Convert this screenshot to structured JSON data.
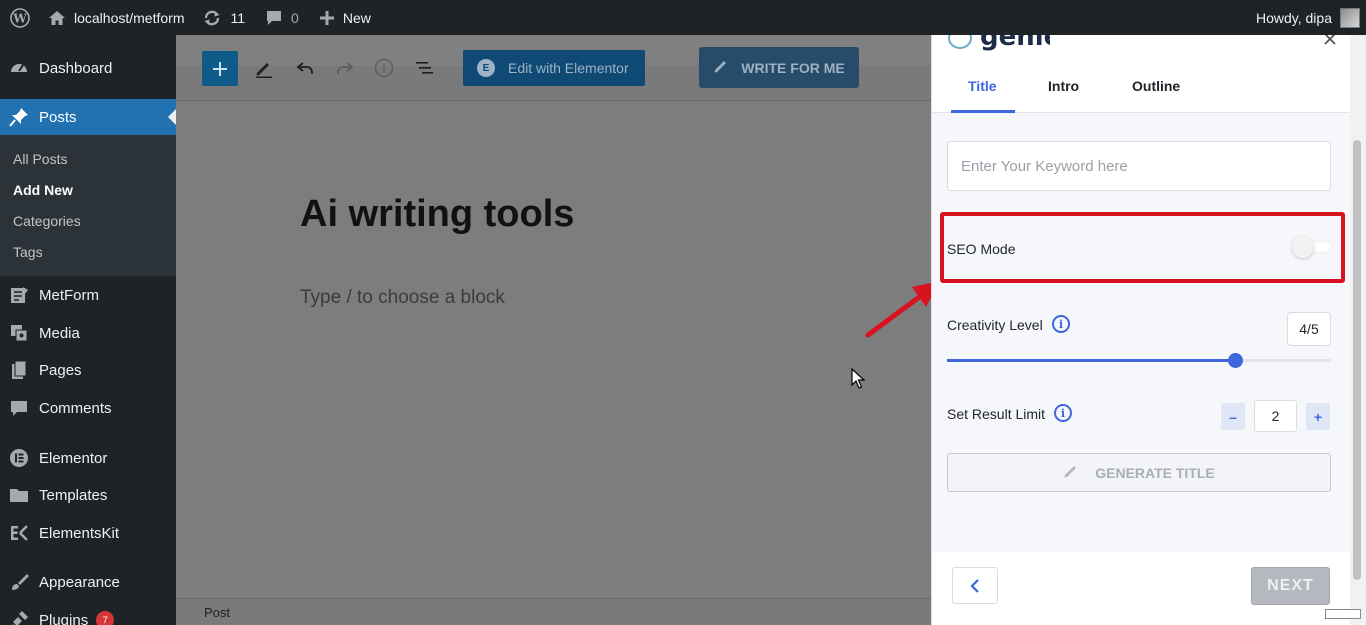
{
  "admin_bar": {
    "site": "localhost/metform",
    "updates_count": "11",
    "comments_count": "0",
    "new_label": "New",
    "greeting": "Howdy, dipa"
  },
  "sidebar": {
    "dashboard": "Dashboard",
    "posts": "Posts",
    "sub": [
      "All Posts",
      "Add New",
      "Categories",
      "Tags"
    ],
    "metform": "MetForm",
    "media": "Media",
    "pages": "Pages",
    "comments": "Comments",
    "elementor": "Elementor",
    "templates": "Templates",
    "elementskit": "ElementsKit",
    "appearance": "Appearance",
    "plugins": "Plugins",
    "plugins_badge": "7"
  },
  "editor": {
    "edit_elementor": "Edit with Elementor",
    "write_for_me": "WRITE FOR ME",
    "post_title": "Ai writing tools",
    "block_placeholder": "Type / to choose a block",
    "footer_label": "Post"
  },
  "panel": {
    "tabs": [
      "Title",
      "Intro",
      "Outline"
    ],
    "active_tab": "Title",
    "keyword_placeholder": "Enter Your Keyword here",
    "keyword_value": "",
    "seo_mode_label": "SEO Mode",
    "seo_mode_on": false,
    "creativity_label": "Creativity Level",
    "creativity_value": "4/5",
    "creativity_fraction": 0.75,
    "result_limit_label": "Set Result Limit",
    "result_limit_value": "2",
    "generate_label": "GENERATE TITLE",
    "next_label": "NEXT",
    "accent_color": "#3e66dd",
    "highlight_color": "#d9121f"
  }
}
